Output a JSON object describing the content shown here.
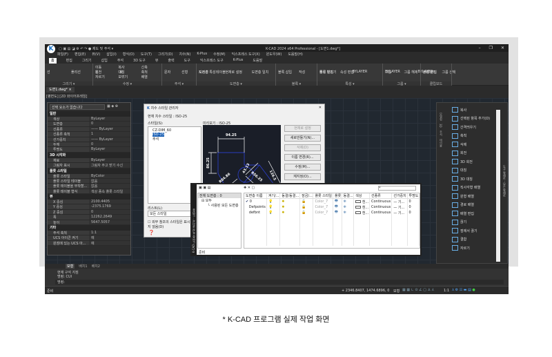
{
  "window": {
    "title": "K-CAD 2024 x64 Professional - [도면1.dwg*]",
    "logo": "K",
    "controls": [
      "–",
      "❐",
      "✕"
    ]
  },
  "quick_access": {
    "workspace": "제도 및 주석"
  },
  "menu": [
    "파일(F)",
    "편집(E)",
    "뷰(V)",
    "삽입(I)",
    "형식(O)",
    "도구(T)",
    "그리기(D)",
    "치수(N)",
    "K-Plus",
    "수정(M)",
    "익스프레스 도구(X)",
    "윈도우(W)",
    "도움말(H)"
  ],
  "ribbon_tabs": [
    "홈",
    "편집",
    "그리기",
    "삽입",
    "주석",
    "3D 도구",
    "뷰",
    "출력",
    "도구",
    "익스프레스 도구",
    "K-Plus",
    "도움말"
  ],
  "ribbon_groups": [
    {
      "label": "그리기 ▾",
      "buttons": [
        "선",
        "폴리선",
        "원",
        "호"
      ]
    },
    {
      "label": "수정 ▾",
      "buttons": [
        "이동",
        "회전",
        "자르기",
        "복사",
        "대칭",
        "모깎기",
        "신축",
        "축척",
        "배열"
      ]
    },
    {
      "label": "주석 ▾",
      "buttons": [
        "문자",
        "선형",
        "지시선",
        "테이블"
      ]
    },
    {
      "label": "도면층 ▾",
      "buttons": [
        "도면층 특성",
        "현재로 설정",
        "도면층 일치"
      ]
    },
    {
      "label": "블록 ▾",
      "buttons": [
        "블록 삽입",
        "작성",
        "블록 편집기",
        "속성 편집"
      ]
    },
    {
      "label": "특성 ▾",
      "buttons": [
        "특성 일치",
        "BYLAYER",
        "BYLAYER",
        "BYLAYER"
      ]
    },
    {
      "label": "그룹 ▾",
      "buttons": [
        "그룹",
        "그룹 해제",
        "그룹 편집",
        "그룹 선택"
      ]
    },
    {
      "label": "클립보드",
      "buttons": [
        "붙여넣기"
      ]
    }
  ],
  "doc_tab": "도면1.dwg*",
  "viewport_label": "[평면도] [2D 와이어프레임]",
  "properties": {
    "selector": "선택 요소가 없습니다",
    "sections": [
      {
        "title": "일반",
        "rows": [
          [
            "색상",
            "ByLayer"
          ],
          [
            "도면층",
            "0"
          ],
          [
            "선종류",
            "—— ByLayer"
          ],
          [
            "선종류 축척",
            "1"
          ],
          [
            "선가중치",
            "—— ByLayer"
          ],
          [
            "두께",
            "0"
          ],
          [
            "투명도",
            "ByLayer"
          ]
        ]
      },
      {
        "title": "3D 시각화",
        "rows": [
          [
            "재료",
            "ByLayer"
          ],
          [
            "그림자 표시",
            "그림자 주고 받기 수신"
          ]
        ]
      },
      {
        "title": "플롯 스타일",
        "rows": [
          [
            "플롯 스타일",
            "ByColor"
          ],
          [
            "플롯 스타일 테이블",
            "없음"
          ],
          [
            "플롯 테이블을 부착할...",
            "없음"
          ],
          [
            "플롯 테이블 형식",
            "색상 종속 플롯 스타일"
          ]
        ]
      },
      {
        "title": "뷰",
        "rows": [
          [
            "X 중심",
            "2100.4405"
          ],
          [
            "Y 중심",
            "-2375.1769"
          ],
          [
            "Z 중심",
            "0"
          ],
          [
            "폭",
            "12262.2649"
          ],
          [
            "높이",
            "5647.5057"
          ]
        ]
      },
      {
        "title": "기타",
        "rows": [
          [
            "주석 축척",
            "1:1"
          ],
          [
            "UCS 아이콘 켜기",
            "예"
          ],
          [
            "원점에 있는 UCS 아...",
            "예"
          ]
        ]
      }
    ]
  },
  "dim_dialog": {
    "title": "치수 스타일 관리자",
    "current": "현재 치수 스타일 : ISO-25",
    "styles_label": "스타일(S):",
    "styles": [
      "CZ-DIM_60",
      "ISO-25",
      "주석"
    ],
    "preview_label": "미리보기 : ISO-25",
    "list_label": "리스트(L):",
    "list_value": "모든 스타일",
    "xref_check": "외부 참조의 스타일은 표시하지 않음(D)",
    "buttons": [
      "현재로 설정",
      "새로만들기(N)...",
      "삭제(D)",
      "이름 변경(R)...",
      "수정(M)...",
      "재지정(O)..."
    ],
    "dims": [
      "94.25",
      "86.25",
      "43.13",
      "126.5",
      "R56.25",
      "R84.86"
    ]
  },
  "layer_manager": {
    "side_title": "K-CAD 도면층 특성 관리자 - 도면층",
    "filter_header": "전체 도면층 : 0",
    "tree": [
      "모두",
      "사용된 모든 도면층"
    ],
    "search": "*",
    "status": "준비",
    "columns": [
      "도면층 이름",
      "켜기/...",
      "동결/동결...",
      "잠금/...",
      "플롯 스타일",
      "플롯",
      "동결...",
      "색상",
      "선종류",
      "선가중치",
      "투명도"
    ],
    "rows": [
      {
        "name": "0",
        "current": true,
        "plot_style": "Color_7",
        "color": "흰...",
        "linetype": "Continuous",
        "lineweight": "—  기...",
        "transparency": "0"
      },
      {
        "name": "Defpoints",
        "current": false,
        "plot_style": "Color_7",
        "color": "흰...",
        "linetype": "Continuous",
        "lineweight": "—  기...",
        "transparency": "0"
      },
      {
        "name": "defbnt",
        "current": false,
        "plot_style": "Color_7",
        "color": "흰...",
        "linetype": "Continuous",
        "lineweight": "—  기...",
        "transparency": "0"
      }
    ]
  },
  "palette": {
    "title": "도구 팔레트 - 모든 팔레트",
    "tabs": [
      "모델링",
      "3D",
      "주석",
      "테이블"
    ],
    "items": [
      "복사",
      "선택된 항목 추가(D)",
      "간격띄우기",
      "축척",
      "삭제",
      "회전",
      "3D 회전",
      "대칭",
      "3D 대칭",
      "직사각형 배열",
      "원형 배열",
      "경로 배열",
      "배열 편집",
      "끊기",
      "점에서 끊기",
      "결합",
      "자르기"
    ]
  },
  "layout_tabs": [
    "모형",
    "배치1",
    "배치2"
  ],
  "command": {
    "history": [
      "현재 구석 지점",
      "명령: CUI"
    ],
    "prompt": "명령:"
  },
  "status": {
    "left": "준비",
    "coords": "2346.8407, 1474.6896, 0",
    "model": "모형",
    "scale": "1:1"
  },
  "caption": "* K-CAD 프로그램 실제 작업 화면"
}
